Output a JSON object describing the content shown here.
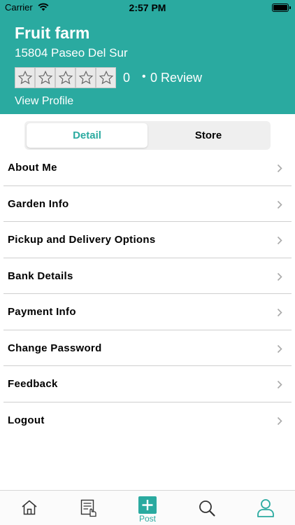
{
  "status_bar": {
    "carrier": "Carrier",
    "time": "2:57 PM"
  },
  "header": {
    "name": "Fruit farm",
    "address": "15804 Paseo Del Sur",
    "rating": {
      "stars_filled": 0,
      "stars_total": 5,
      "value": "0",
      "dot": "•",
      "review_text": "0 Review"
    },
    "view_profile": "View Profile"
  },
  "segment": {
    "detail": "Detail",
    "store": "Store",
    "selected": "Detail"
  },
  "menu": [
    {
      "label": "About Me"
    },
    {
      "label": "Garden Info"
    },
    {
      "label": "Pickup and Delivery Options"
    },
    {
      "label": "Bank Details"
    },
    {
      "label": "Payment Info"
    },
    {
      "label": "Change Password"
    },
    {
      "label": "Feedback"
    },
    {
      "label": "Logout"
    }
  ],
  "tabbar": {
    "home_icon": "home-icon",
    "orders_icon": "orders-list-icon",
    "post_label": "Post",
    "search_icon": "search-icon",
    "profile_icon": "profile-icon",
    "selected": "Post"
  },
  "colors": {
    "accent": "#2aaaa0",
    "header_text": "#ffffff"
  }
}
